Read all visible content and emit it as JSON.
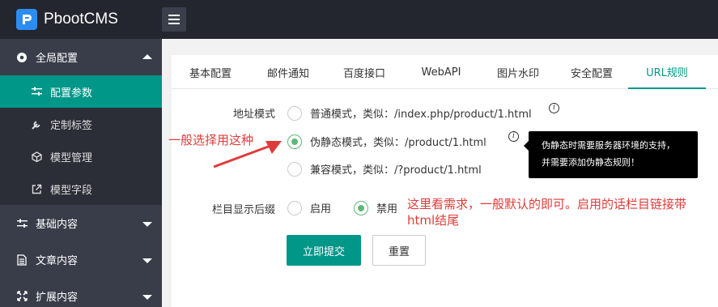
{
  "header": {
    "app_name": "PbootCMS"
  },
  "sidebar": {
    "items": [
      {
        "label": "全局配置",
        "open": true,
        "children": [
          {
            "label": "配置参数",
            "active": true
          },
          {
            "label": "定制标签"
          },
          {
            "label": "模型管理"
          },
          {
            "label": "模型字段"
          }
        ]
      },
      {
        "label": "基础内容"
      },
      {
        "label": "文章内容"
      },
      {
        "label": "扩展内容"
      }
    ]
  },
  "tabs": [
    "基本配置",
    "邮件通知",
    "百度接口",
    "WebAPI",
    "图片水印",
    "安全配置",
    "URL规则"
  ],
  "active_tab": "URL规则",
  "form": {
    "address_mode": {
      "label": "地址模式",
      "options": [
        {
          "label": "普通模式，类似：/index.php/product/1.html",
          "checked": false
        },
        {
          "label": "伪静态模式，类似：/product/1.html",
          "checked": true
        },
        {
          "label": "兼容模式，类似：/?product/1.html",
          "checked": false
        }
      ]
    },
    "suffix": {
      "label": "栏目显示后缀",
      "options": [
        {
          "label": "启用",
          "checked": false
        },
        {
          "label": "禁用",
          "checked": true
        }
      ]
    },
    "submit_label": "立即提交",
    "reset_label": "重置"
  },
  "tooltip": {
    "line1": "伪静态时需要服务器环境的支持，",
    "line2": "并需要添加伪静态规则！"
  },
  "annotations": {
    "left": "一般选择用这种",
    "right_line1": "这里看需求，一般默认的即可。启用的话栏目链接带",
    "right_line2": "html结尾",
    "color": "#e03b3b"
  },
  "colors": {
    "accent": "#009688",
    "radio_checked": "#5fb878",
    "sidebar": "#393d49",
    "header": "#23262e"
  }
}
